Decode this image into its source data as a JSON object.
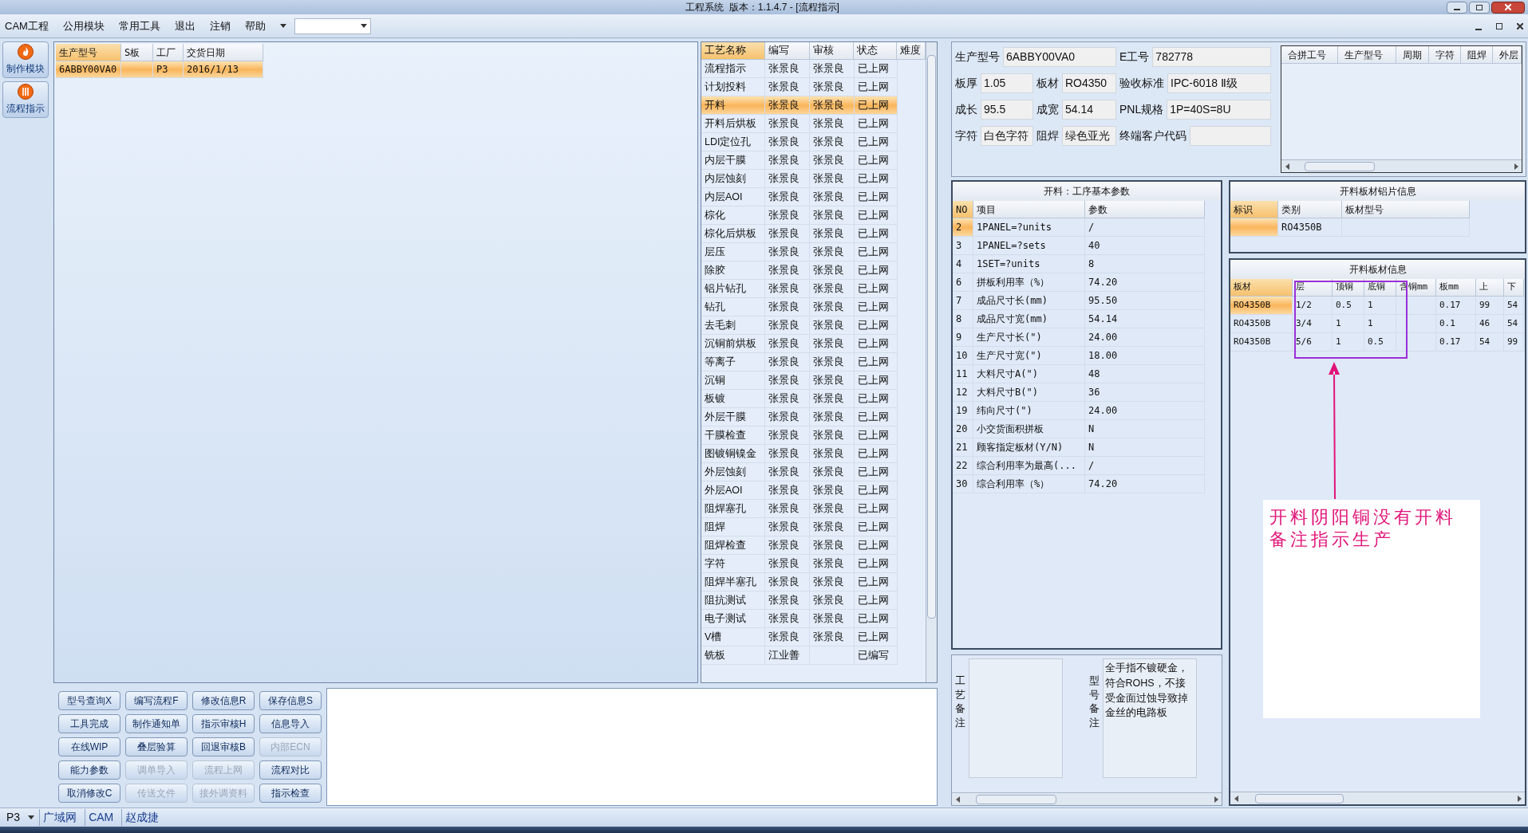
{
  "window": {
    "title": "工程系统  版本：1.1.4.7 - [流程指示]"
  },
  "menu": [
    {
      "label": "CAM工程"
    },
    {
      "label": "公用模块"
    },
    {
      "label": "常用工具"
    },
    {
      "label": "退出"
    },
    {
      "label": "注销"
    },
    {
      "label": "帮助"
    }
  ],
  "sidebar": [
    {
      "label": "制作模块"
    },
    {
      "label": "流程指示"
    }
  ],
  "orders": {
    "columns": [
      "生产型号",
      "S板",
      "工厂",
      "交货日期"
    ],
    "rows": [
      {
        "cells": [
          "6ABBY00VA0",
          "",
          "P3",
          "2016/1/13"
        ],
        "selected": true
      }
    ]
  },
  "process": {
    "columns": [
      "工艺名称",
      "编写",
      "审核",
      "状态",
      "难度"
    ],
    "rows": [
      {
        "cells": [
          "流程指示",
          "张景良",
          "张景良",
          "已上网"
        ],
        "selected": false
      },
      {
        "cells": [
          "计划投料",
          "张景良",
          "张景良",
          "已上网"
        ],
        "selected": false
      },
      {
        "cells": [
          "开料",
          "张景良",
          "张景良",
          "已上网"
        ],
        "selected": true
      },
      {
        "cells": [
          "开料后烘板",
          "张景良",
          "张景良",
          "已上网"
        ],
        "selected": false
      },
      {
        "cells": [
          "LDI定位孔",
          "张景良",
          "张景良",
          "已上网"
        ],
        "selected": false
      },
      {
        "cells": [
          "内层干膜",
          "张景良",
          "张景良",
          "已上网"
        ],
        "selected": false
      },
      {
        "cells": [
          "内层蚀刻",
          "张景良",
          "张景良",
          "已上网"
        ],
        "selected": false
      },
      {
        "cells": [
          "内层AOI",
          "张景良",
          "张景良",
          "已上网"
        ],
        "selected": false
      },
      {
        "cells": [
          "棕化",
          "张景良",
          "张景良",
          "已上网"
        ],
        "selected": false
      },
      {
        "cells": [
          "棕化后烘板",
          "张景良",
          "张景良",
          "已上网"
        ],
        "selected": false
      },
      {
        "cells": [
          "层压",
          "张景良",
          "张景良",
          "已上网"
        ],
        "selected": false
      },
      {
        "cells": [
          "除胶",
          "张景良",
          "张景良",
          "已上网"
        ],
        "selected": false
      },
      {
        "cells": [
          "铝片钻孔",
          "张景良",
          "张景良",
          "已上网"
        ],
        "selected": false
      },
      {
        "cells": [
          "钻孔",
          "张景良",
          "张景良",
          "已上网"
        ],
        "selected": false
      },
      {
        "cells": [
          "去毛刺",
          "张景良",
          "张景良",
          "已上网"
        ],
        "selected": false
      },
      {
        "cells": [
          "沉铜前烘板",
          "张景良",
          "张景良",
          "已上网"
        ],
        "selected": false
      },
      {
        "cells": [
          "等离子",
          "张景良",
          "张景良",
          "已上网"
        ],
        "selected": false
      },
      {
        "cells": [
          "沉铜",
          "张景良",
          "张景良",
          "已上网"
        ],
        "selected": false
      },
      {
        "cells": [
          "板镀",
          "张景良",
          "张景良",
          "已上网"
        ],
        "selected": false
      },
      {
        "cells": [
          "外层干膜",
          "张景良",
          "张景良",
          "已上网"
        ],
        "selected": false
      },
      {
        "cells": [
          "干膜检查",
          "张景良",
          "张景良",
          "已上网"
        ],
        "selected": false
      },
      {
        "cells": [
          "图镀铜镍金",
          "张景良",
          "张景良",
          "已上网"
        ],
        "selected": false
      },
      {
        "cells": [
          "外层蚀刻",
          "张景良",
          "张景良",
          "已上网"
        ],
        "selected": false
      },
      {
        "cells": [
          "外层AOI",
          "张景良",
          "张景良",
          "已上网"
        ],
        "selected": false
      },
      {
        "cells": [
          "阻焊塞孔",
          "张景良",
          "张景良",
          "已上网"
        ],
        "selected": false
      },
      {
        "cells": [
          "阻焊",
          "张景良",
          "张景良",
          "已上网"
        ],
        "selected": false
      },
      {
        "cells": [
          "阻焊检查",
          "张景良",
          "张景良",
          "已上网"
        ],
        "selected": false
      },
      {
        "cells": [
          "字符",
          "张景良",
          "张景良",
          "已上网"
        ],
        "selected": false
      },
      {
        "cells": [
          "阻焊半塞孔",
          "张景良",
          "张景良",
          "已上网"
        ],
        "selected": false
      },
      {
        "cells": [
          "阻抗测试",
          "张景良",
          "张景良",
          "已上网"
        ],
        "selected": false
      },
      {
        "cells": [
          "电子测试",
          "张景良",
          "张景良",
          "已上网"
        ],
        "selected": false
      },
      {
        "cells": [
          "V槽",
          "张景良",
          "张景良",
          "已上网"
        ],
        "selected": false
      },
      {
        "cells": [
          "铣板",
          "江业善",
          "",
          "已编写"
        ],
        "selected": false
      }
    ]
  },
  "info": {
    "rows": [
      [
        {
          "label": "生产型号",
          "value": "6ABBY00VA0"
        },
        "",
        {
          "label": "E工号",
          "value": "782778"
        }
      ],
      [
        {
          "label": "板厚",
          "value": "1.05"
        },
        {
          "label": "板材",
          "value": "RO4350"
        },
        {
          "label": "验收标准",
          "value": "IPC-6018 Ⅱ级"
        }
      ],
      [
        {
          "label": "成长",
          "value": "95.5"
        },
        {
          "label": "成宽",
          "value": "54.14"
        },
        {
          "label": "PNL规格",
          "value": "1P=40S=8U"
        }
      ],
      [
        {
          "label": "字符",
          "value": "白色字符"
        },
        {
          "label": "阻焊",
          "value": "绿色亚光"
        },
        {
          "label": "终端客户代码"
        }
      ]
    ]
  },
  "merged": {
    "columns": [
      "合拼工号",
      "生产型号",
      "周期",
      "字符",
      "阻焊",
      "外层"
    ]
  },
  "params": {
    "title": "开料：工序基本参数",
    "columns": [
      "NO",
      "项目",
      "参数"
    ],
    "rows": [
      {
        "cells": [
          "2",
          "1PANEL=?units",
          "/"
        ],
        "selected": true
      },
      {
        "cells": [
          "3",
          "1PANEL=?sets",
          "40"
        ],
        "selected": false
      },
      {
        "cells": [
          "4",
          "1SET=?units",
          "8"
        ],
        "selected": false
      },
      {
        "cells": [
          "6",
          "拼板利用率（%）",
          "74.20"
        ],
        "selected": false
      },
      {
        "cells": [
          "7",
          "成品尺寸长(mm)",
          "95.50"
        ],
        "selected": false
      },
      {
        "cells": [
          "8",
          "成品尺寸宽(mm)",
          "54.14"
        ],
        "selected": false
      },
      {
        "cells": [
          "9",
          "生产尺寸长(\")",
          "24.00"
        ],
        "selected": false
      },
      {
        "cells": [
          "10",
          "生产尺寸宽(\")",
          "18.00"
        ],
        "selected": false
      },
      {
        "cells": [
          "11",
          "大料尺寸A(\")",
          "48"
        ],
        "selected": false
      },
      {
        "cells": [
          "12",
          "大料尺寸B(\")",
          "36"
        ],
        "selected": false
      },
      {
        "cells": [
          "19",
          "纬向尺寸(\")",
          "24.00"
        ],
        "selected": false
      },
      {
        "cells": [
          "20",
          "小交货面积拼板",
          "N"
        ],
        "selected": false
      },
      {
        "cells": [
          "21",
          "顾客指定板材(Y/N)",
          "N"
        ],
        "selected": false
      },
      {
        "cells": [
          "22",
          "综合利用率为最高(...",
          "/"
        ],
        "selected": false
      },
      {
        "cells": [
          "30",
          "综合利用率（%）",
          "74.20"
        ],
        "selected": false
      }
    ]
  },
  "foil": {
    "title": "开料板材铝片信息",
    "columns": [
      "标识",
      "类别",
      "板材型号"
    ],
    "rows": [
      {
        "cells": [
          "",
          "RO4350B",
          ""
        ],
        "selected": true
      }
    ]
  },
  "plates": {
    "title": "开料板材信息",
    "columns": [
      "板材",
      "层",
      "顶铜",
      "底铜",
      "含铜mm",
      "板mm",
      "上",
      "下"
    ],
    "rows": [
      {
        "cells": [
          "RO4350B",
          "1/2",
          "0.5",
          "1",
          "",
          "0.17",
          "99",
          "54"
        ],
        "selected": true
      },
      {
        "cells": [
          "RO4350B",
          "3/4",
          "1",
          "1",
          "",
          "0.1",
          "46",
          "54"
        ],
        "selected": false
      },
      {
        "cells": [
          "RO4350B",
          "5/6",
          "1",
          "0.5",
          "",
          "0.17",
          "54",
          "99"
        ],
        "selected": false
      }
    ]
  },
  "note": {
    "text": "开料阴阳铜没有开料备注指示生产"
  },
  "buttons": [
    {
      "label": "型号查询X",
      "disabled": false
    },
    {
      "label": "编写流程F",
      "disabled": false
    },
    {
      "label": "修改信息R",
      "disabled": false
    },
    {
      "label": "保存信息S",
      "disabled": false
    },
    {
      "label": "工具完成",
      "disabled": false
    },
    {
      "label": "制作通知单",
      "disabled": false
    },
    {
      "label": "指示审核H",
      "disabled": false
    },
    {
      "label": "信息导入",
      "disabled": false
    },
    {
      "label": "在线WIP",
      "disabled": false
    },
    {
      "label": "叠层验算",
      "disabled": false
    },
    {
      "label": "回退审核B",
      "disabled": false
    },
    {
      "label": "内部ECN",
      "disabled": true
    },
    {
      "label": "能力参数",
      "disabled": false
    },
    {
      "label": "调单导入",
      "disabled": true
    },
    {
      "label": "流程上网",
      "disabled": true
    },
    {
      "label": "流程对比",
      "disabled": false
    },
    {
      "label": "取消修改C",
      "disabled": false
    },
    {
      "label": "传送文件",
      "disabled": true
    },
    {
      "label": "接外调资料",
      "disabled": true
    },
    {
      "label": "指示检查",
      "disabled": false
    }
  ],
  "remarks": [
    {
      "label": "工艺备注"
    },
    {
      "label": "型号备注",
      "text": "全手指不镀硬金，符合ROHS，不接受金面过蚀导致掉金丝的电路板"
    }
  ],
  "status_bar": [
    {
      "label": "P3"
    },
    {
      "label": "广域网"
    },
    {
      "label": "CAM"
    },
    {
      "label": "赵成捷"
    }
  ]
}
